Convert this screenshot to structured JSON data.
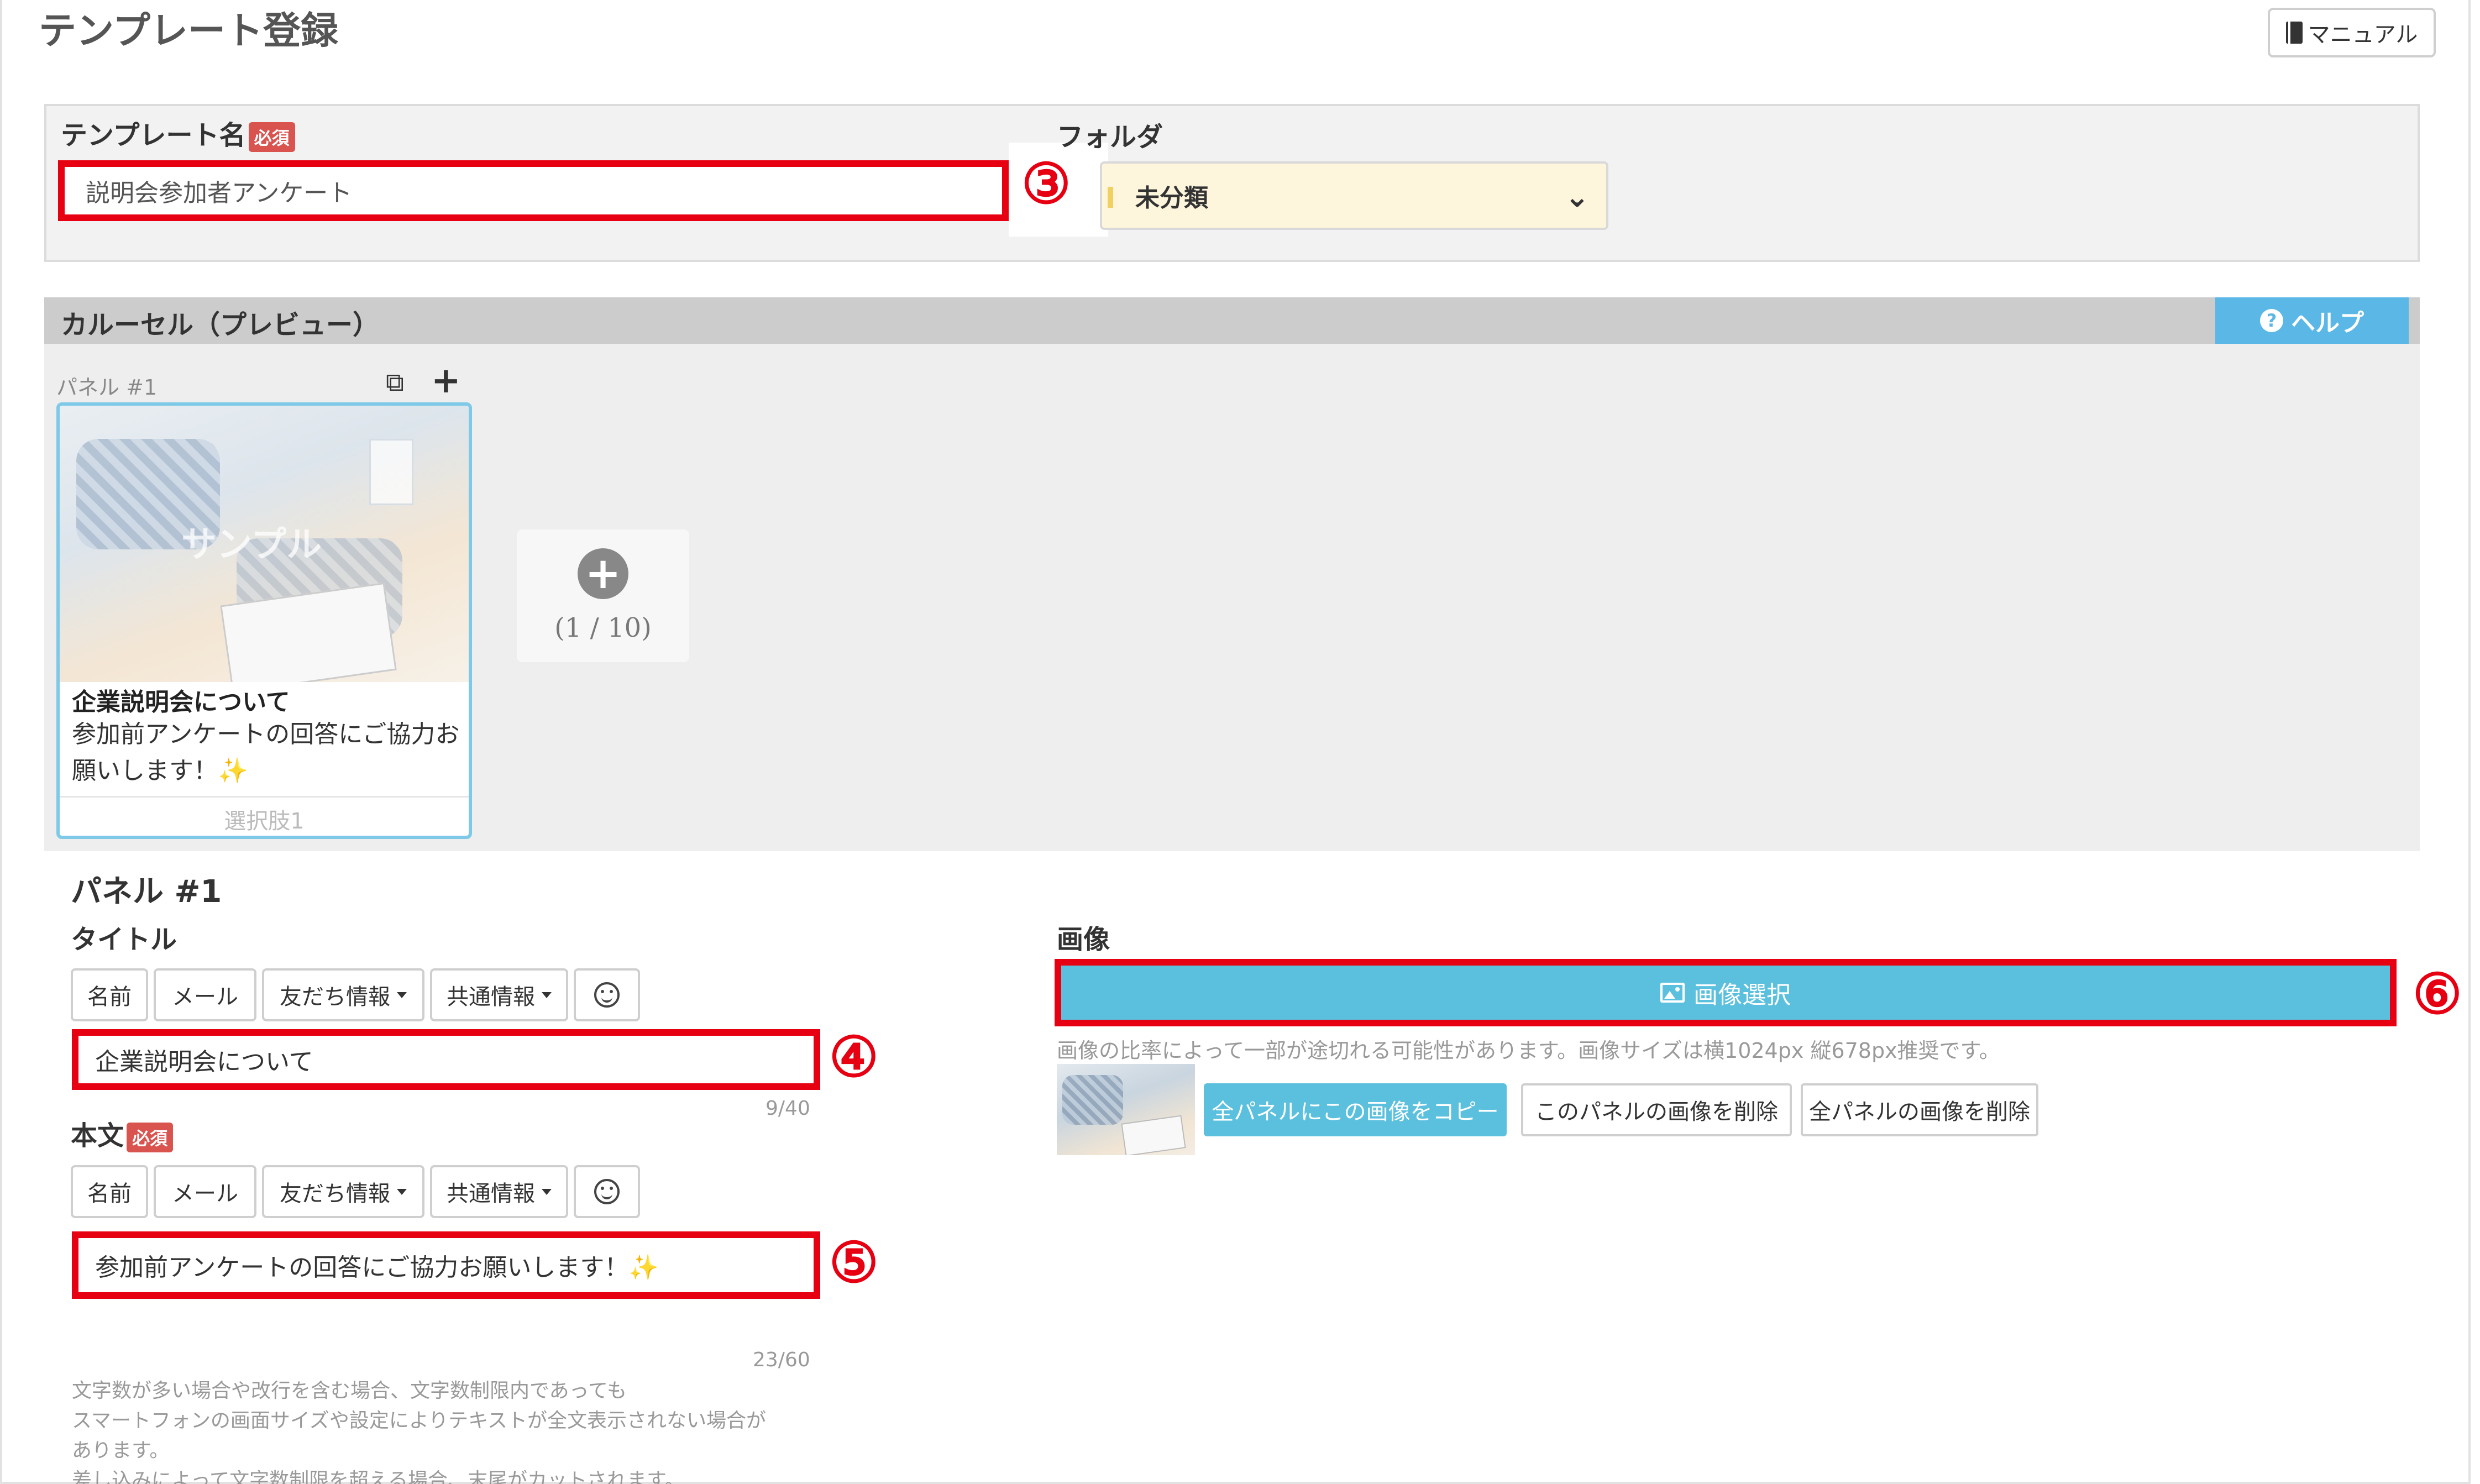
{
  "page": {
    "title": "テンプレート登録",
    "manual_label": "マニュアル"
  },
  "template": {
    "name_label": "テンプレート名",
    "required_badge": "必須",
    "name_value": "説明会参加者アンケート",
    "folder_label": "フォルダ",
    "folder_value": "未分類"
  },
  "callouts": {
    "c3": "③",
    "c4": "④",
    "c5": "⑤",
    "c6": "⑥"
  },
  "carousel": {
    "title": "カルーセル（プレビュー）",
    "help_label": "ヘルプ",
    "panel_label_small": "パネル #1",
    "card": {
      "watermark": "サンプル",
      "title": "企業説明会について",
      "text": "参加前アンケートの回答にご協力お願いします！✨",
      "choice": "選択肢1"
    },
    "add_count": "(1 / 10)"
  },
  "panel": {
    "heading": "パネル #1",
    "title_label": "タイトル",
    "title_value": "企業説明会について",
    "title_counter": "9/40",
    "body_label": "本文",
    "body_value": "参加前アンケートの回答にご協力お願いします！✨",
    "body_counter": "23/60",
    "insert_buttons": {
      "name": "名前",
      "mail": "メール",
      "friend": "友だち情報",
      "common": "共通情報"
    },
    "note": [
      "文字数が多い場合や改行を含む場合、文字数制限内であっても",
      "スマートフォンの画面サイズや設定によりテキストが全文表示されない場合が",
      "あります。",
      "差し込みによって文字数制限を超える場合、末尾がカットされます。"
    ]
  },
  "image": {
    "label": "画像",
    "select_label": "画像選択",
    "note": "画像の比率によって一部が途切れる可能性があります。画像サイズは横1024px 縦678px推奨です。",
    "copy_all": "全パネルにこの画像をコピー",
    "delete_this": "このパネルの画像を削除",
    "delete_all": "全パネルの画像を削除"
  },
  "colors": {
    "accent_red": "#e60012",
    "info_blue": "#5bc0de",
    "help_blue": "#5ab7e6",
    "required_red": "#d9534f"
  },
  "icons": [
    "book-icon",
    "chevron-down-icon",
    "question-icon",
    "copy-icon",
    "plus-icon",
    "add-circle-icon",
    "emoji-icon",
    "picture-icon"
  ]
}
